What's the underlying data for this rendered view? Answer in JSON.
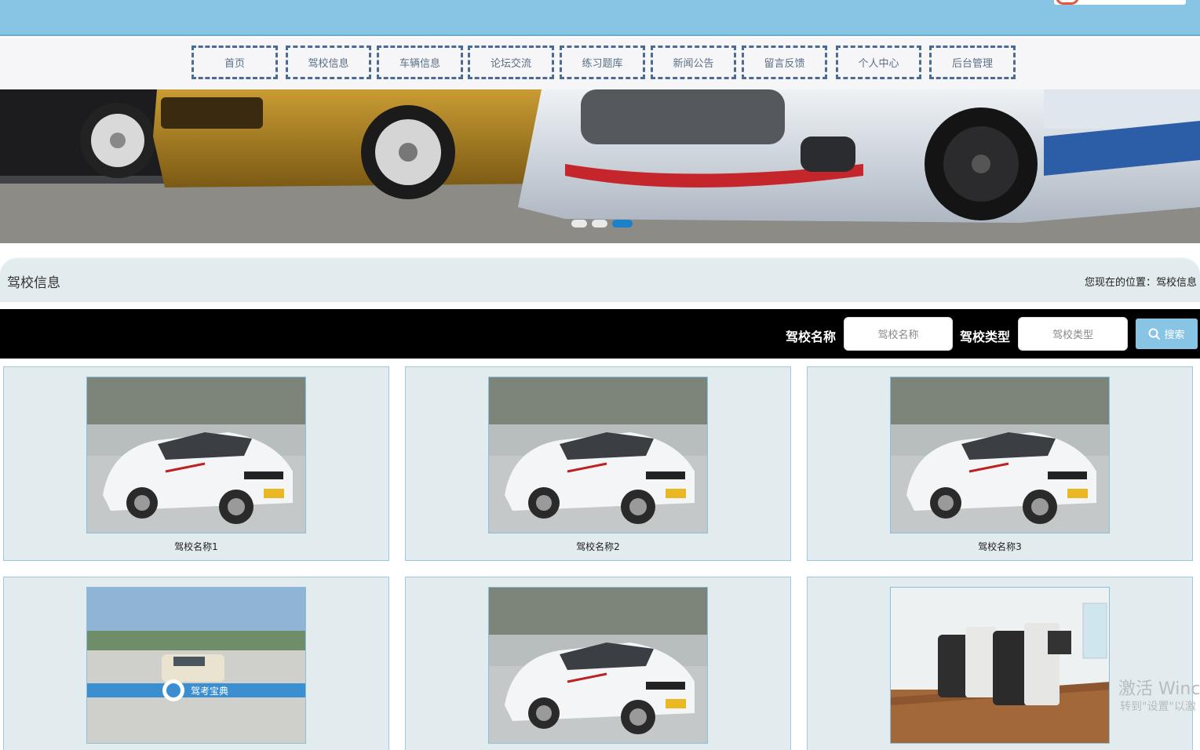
{
  "nav": {
    "items": [
      {
        "label": "首页"
      },
      {
        "label": "驾校信息"
      },
      {
        "label": "车辆信息"
      },
      {
        "label": "论坛交流"
      },
      {
        "label": "练习题库"
      },
      {
        "label": "新闻公告"
      },
      {
        "label": "留言反馈"
      },
      {
        "label": "个人中心"
      },
      {
        "label": "后台管理"
      }
    ]
  },
  "banner": {
    "active_slide": 3,
    "slide_count": 3
  },
  "section": {
    "title": "驾校信息",
    "breadcrumb": "您现在的位置：驾校信息"
  },
  "search": {
    "name_label": "驾校名称",
    "name_placeholder": "驾校名称",
    "type_label": "驾校类型",
    "type_placeholder": "驾校类型",
    "button_label": "搜索"
  },
  "cards": [
    {
      "caption": "驾校名称1",
      "image": "white-training-car"
    },
    {
      "caption": "驾校名称2",
      "image": "white-training-car"
    },
    {
      "caption": "驾校名称3",
      "image": "white-training-car"
    },
    {
      "caption": "",
      "image": "driving-test-field"
    },
    {
      "caption": "",
      "image": "white-training-car"
    },
    {
      "caption": "",
      "image": "driving-simulator-room"
    }
  ],
  "field_logo_text": "驾考宝典",
  "watermark": {
    "line1": "激活 Winc",
    "line2": "转到\"设置\"以激"
  }
}
